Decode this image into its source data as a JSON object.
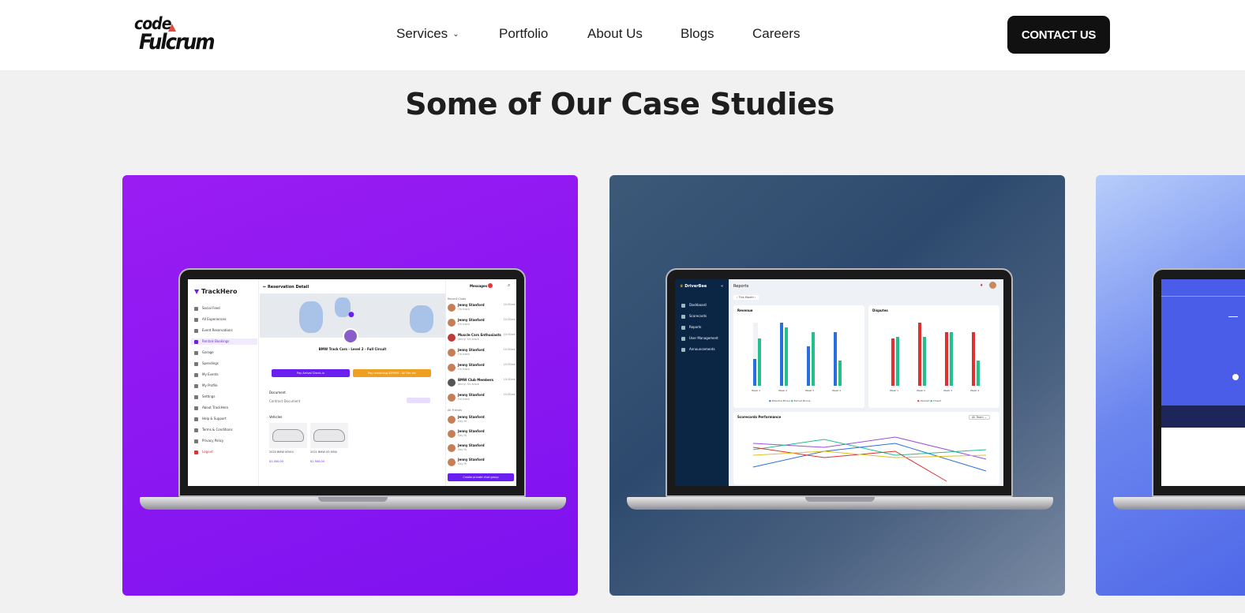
{
  "header": {
    "logo_line1": "code",
    "logo_line2": "Fulcrum",
    "nav": [
      {
        "label": "Services"
      },
      {
        "label": "Portfolio"
      },
      {
        "label": "About Us"
      },
      {
        "label": "Blogs"
      },
      {
        "label": "Careers"
      }
    ],
    "contact_label": "CONTACT US"
  },
  "main": {
    "title": "Some of Our Case Studies"
  },
  "trackhero": {
    "brand": "TrackHero",
    "sidebar": [
      "Social Feed",
      "All Experiences",
      "Event Reservations",
      "Rentals Bookings",
      "Garage",
      "Spendings",
      "My Events",
      "My Profile",
      "Settings",
      "About TrackHero",
      "Help & Support",
      "Terms & Conditions",
      "Privacy Policy",
      "Logout"
    ],
    "page_title": "Reservation Detail",
    "messages_label": "Messages",
    "event_title": "BMW Track Cars - Level 2 - Full Circuit",
    "btn1": "Pay Arrival Check-in",
    "btn2": "Pay remaining $99999 - All Fee etc",
    "document_label": "Document",
    "contract_label": "Contract Document",
    "vehicles_label": "Vehicles",
    "car1_name": "2020 BMW M340i",
    "car1_price": "$1,000.00",
    "car2_name": "2021 BMW X5 M50i",
    "car2_price": "$1,500.00",
    "recent_chats": "Recent Chats",
    "all_friends": "All Friends",
    "chats": [
      {
        "name": "Jenny Stanford",
        "sub": "On track",
        "time": "10:30am"
      },
      {
        "name": "Jenny Stanford",
        "sub": "On track",
        "time": "10:30am"
      },
      {
        "name": "Muscle Cars Enthusiasts",
        "sub": "Jenny: On track",
        "time": "10:30am"
      },
      {
        "name": "Jenny Stanford",
        "sub": "On track",
        "time": "10:30am"
      },
      {
        "name": "Jenny Stanford",
        "sub": "On track",
        "time": "10:30am"
      },
      {
        "name": "BMW Club Members",
        "sub": "Jenny: On track",
        "time": "10:30am"
      },
      {
        "name": "Jenny Stanford",
        "sub": "On track",
        "time": "10:30am"
      }
    ],
    "friends": [
      {
        "name": "Jenny Stanford",
        "sub": "Say Hi"
      },
      {
        "name": "Jenny Stanford",
        "sub": "Say Hi"
      },
      {
        "name": "Jenny Stanford",
        "sub": "Say Hi"
      },
      {
        "name": "Jenny Stanford",
        "sub": "Say Hi"
      }
    ],
    "create_group": "Create private chat group"
  },
  "driverbee": {
    "brand": "DriverBee",
    "sidebar": [
      "Dashboard",
      "Scorecards",
      "Reports",
      "User Management",
      "Announcements"
    ],
    "page_title": "Reports",
    "period": "This Month",
    "revenue_title": "Revenue",
    "disputes_title": "Disputes",
    "weeks": [
      "Week 1",
      "Week 2",
      "Week 3",
      "Week 4"
    ],
    "revenue_legend": [
      "Potential Bonus",
      "Earned Bonus"
    ],
    "disputes_legend": [
      "Opened",
      "Closed"
    ],
    "scorecards_title": "Scorecards Performance",
    "team_select": "All Team"
  },
  "colors": {
    "trackhero_card": "#8a15f2",
    "driverbee_card": "#35506f",
    "accent_purple": "#6a1ff0",
    "accent_orange": "#f0a020",
    "blue_bar": "#2a6fe0",
    "green_bar": "#22c08a",
    "red_bar": "#e03030"
  }
}
